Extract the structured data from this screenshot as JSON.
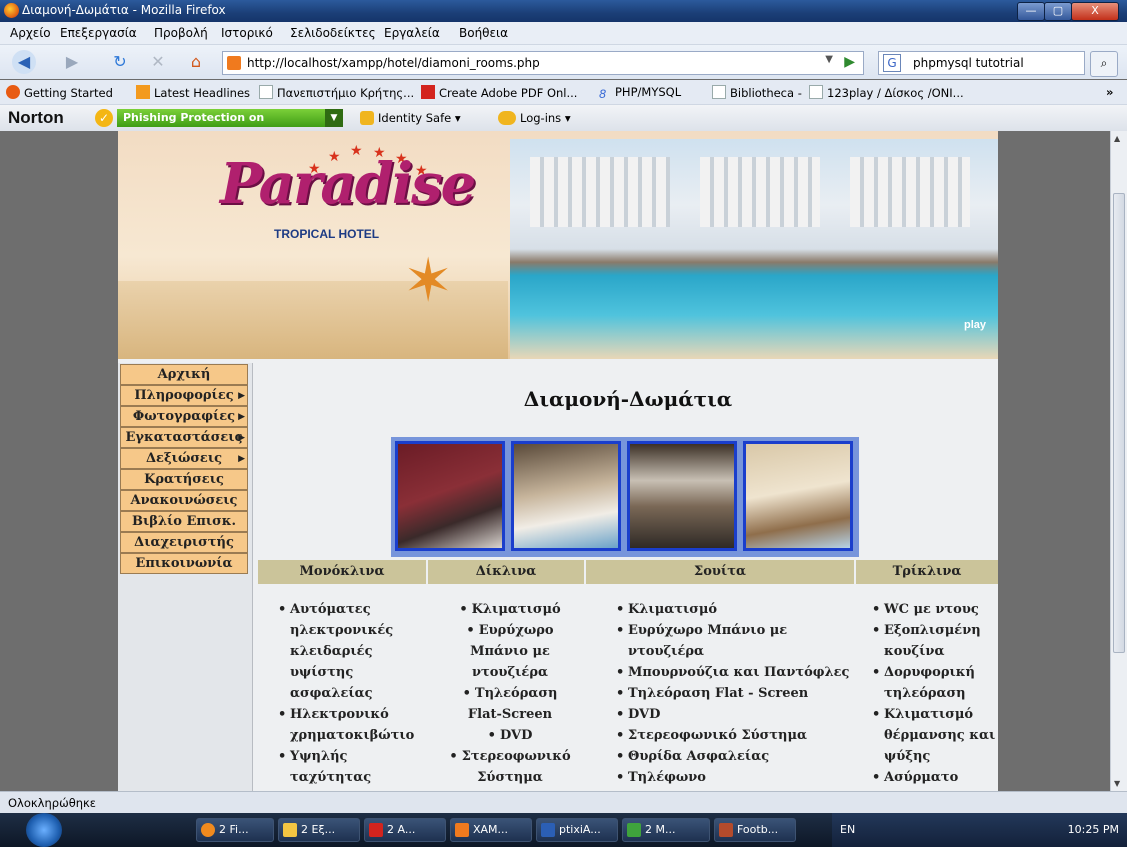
{
  "window": {
    "title": "Διαμονή-Δωμάτια - Mozilla Firefox",
    "min": "—",
    "max": "▢",
    "close": "X"
  },
  "menu": [
    "Αρχείο",
    "Επεξεργασία",
    "Προβολή",
    "Ιστορικό",
    "Σελιδοδείκτες",
    "Εργαλεία",
    "Βοήθεια"
  ],
  "nav": {
    "url": "http://localhost/xampp/hotel/diamoni_rooms.php",
    "search": "phpmysql tutotrial"
  },
  "bookmarks": [
    "Getting Started",
    "Latest Headlines",
    "Πανεπιστήμιο Κρήτης...",
    "Create Adobe PDF Onl...",
    "PHP/MYSQL",
    "Bibliotheca -",
    "123play / Δίσκος /ONI..."
  ],
  "norton": {
    "logo": "Norton",
    "phishing": "Phishing Protection on",
    "identity": "Identity Safe ▾",
    "logins": "Log-ins ▾"
  },
  "banner": {
    "logo": "Paradise",
    "subtitle": "TROPICAL HOTEL",
    "play": "play"
  },
  "sidebar": {
    "items": [
      "Αρχική",
      "Πληροφορίες",
      "Φωτογραφίες",
      "Εγκαταστάσεις",
      "Δεξιώσεις",
      "Κρατήσεις",
      "Ανακοινώσεις",
      "Βιβλίο Επισκ.",
      "Διαχειριστής",
      "Επικοινωνία"
    ]
  },
  "main": {
    "title": "Διαμονή-Δωμάτια",
    "columns": [
      {
        "label": "Μονόκλινα",
        "items": [
          "Αυτόματες ηλεκτρονικές κλειδαριές υψίστης ασφαλείας",
          "Ηλεκτρονικό χρηματοκιβώτιο",
          "Υψηλής ταχύτητας"
        ]
      },
      {
        "label": "Δίκλινα",
        "items": [
          "Κλιματισμό",
          "Ευρύχωρο Μπάνιο με ντουζιέρα",
          "Τηλεόραση Flat-Screen",
          "DVD",
          "Στερεοφωνικό Σύστημα"
        ]
      },
      {
        "label": "Σουίτα",
        "items": [
          "Κλιματισμό",
          "Ευρύχωρο Μπάνιο με ντουζιέρα",
          "Μπουρνούζια και Παντόφλες",
          "Τηλεόραση Flat - Screen",
          "DVD",
          "Στερεοφωνικό Σύστημα",
          "Θυρίδα Ασφαλείας",
          "Τηλέφωνο"
        ]
      },
      {
        "label": "Τρίκλινα",
        "items": [
          "WC με ντους",
          "Εξοπλισμένη κουζίνα",
          "Δορυφορική τηλεόραση",
          "Κλιματισμό θέρμανσης και ψύξης",
          "Ασύρματο"
        ]
      }
    ]
  },
  "status": "Ολοκληρώθηκε",
  "taskbar": {
    "items": [
      "2 Fi...",
      "2 Εξ...",
      "2 A...",
      "XAM...",
      "ptixiA...",
      "2 M...",
      "Footb..."
    ],
    "lang": "EN",
    "clock": "10:25 PM"
  }
}
